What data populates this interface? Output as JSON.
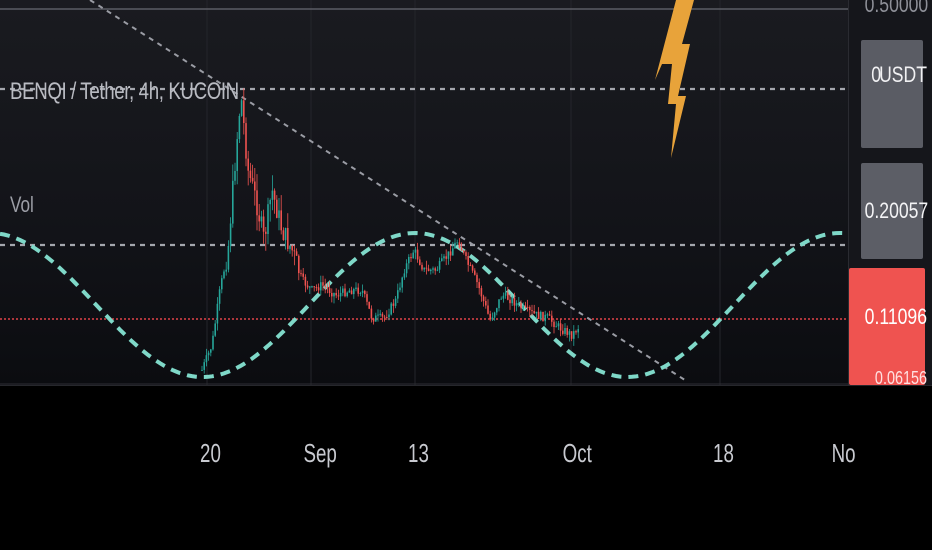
{
  "legend": {
    "symbol_line": "BENQI / Tether, 4h, KUCOIN",
    "volume_label": "Vol"
  },
  "price_scale": {
    "top_partial": "0.50000",
    "currency_badge": "USDT",
    "currency_prefix": "0",
    "level_mid": "0.20057",
    "last_price": "0.11096",
    "bottom_partial": "0.06156"
  },
  "time_axis": {
    "labels": [
      "20",
      "Sep",
      "13",
      "Oct",
      "18",
      "No"
    ]
  },
  "colors": {
    "background": "#131419",
    "bull_candle": "#26a69a",
    "bear_candle": "#ef5350",
    "wave_line": "#7fd8c8",
    "last_price": "#f05350",
    "drawing_orange": "#e8a33a",
    "level_line": "#a5a7ae"
  },
  "icons": [
    "lightning-drawing"
  ]
}
